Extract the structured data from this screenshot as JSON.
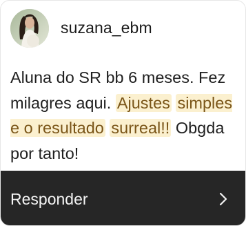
{
  "post": {
    "username": "suzana_ebm",
    "avatar_icon": "profile-photo-avatar",
    "message_parts": {
      "p1": "Aluna do SR bb 6 meses. Fez milagres aqui.",
      "h1": "Ajustes",
      "h2": "simples e o resultado",
      "h3": "surreal!!",
      "p2": "Obgda por tanto!"
    },
    "highlight_color": "#fbf0cf",
    "highlight_text_color": "#7a5518"
  },
  "footer": {
    "reply_label": "Responder",
    "chevron_icon": "chevron-right-icon",
    "background": "#262626"
  }
}
